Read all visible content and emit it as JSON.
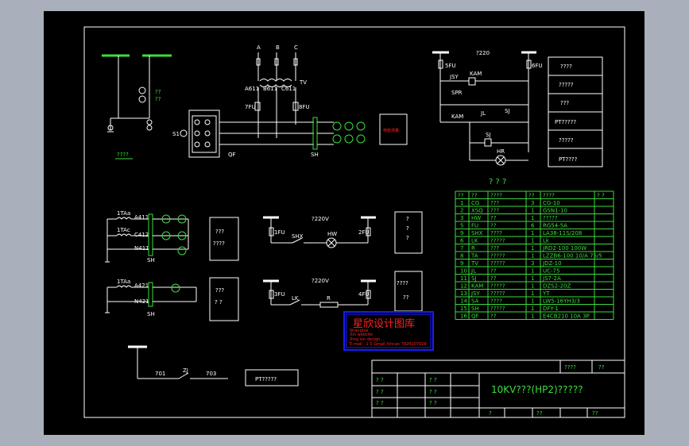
{
  "colors": {
    "background": "#a9b0bc",
    "sheet": "#000000",
    "line": "#ffffff",
    "green": "#3ddc3d",
    "yellow": "#f0f060",
    "stamp_red": "#ff2020",
    "stamp_blue": "#1a1aff"
  },
  "primary": {
    "phases": [
      "A",
      "B",
      "C"
    ],
    "labels": {
      "a611": "A611",
      "b611": "B611",
      "c611": "C611",
      "tv": "TV",
      "fu7": "7FU",
      "fu8": "8FU",
      "s1": "S1",
      "qf": "QF",
      "sh": "SH",
      "qq1": "??",
      "qq2": "??",
      "bottom": "????",
      "box": "电能测量"
    }
  },
  "control": {
    "voltage": "?220",
    "fu5": "5FU",
    "fu6": "6FU",
    "jsy": "JSY",
    "kam1": "KAM",
    "spr": "SPR",
    "kam2": "KAM",
    "jl": "JL",
    "sj1": "SJ",
    "sj2": "SJ",
    "hr": "HR"
  },
  "legend": {
    "items": [
      "????",
      "?????",
      "???",
      "PT?????",
      "?????",
      "PT????"
    ]
  },
  "title_mark": "? ? ?",
  "table": {
    "headers": [
      "??",
      "??",
      "????",
      "??",
      "????",
      "?  ?"
    ],
    "rows": [
      [
        "1",
        "CG",
        "???",
        "3",
        "CG-10",
        ""
      ],
      [
        "2",
        "XSQ",
        "???",
        "1",
        "GSN1-10",
        ""
      ],
      [
        "3",
        "HW",
        "??",
        "1",
        "?????",
        ""
      ],
      [
        "5",
        "FU",
        "??",
        "6",
        "RG54-5A",
        ""
      ],
      [
        "9",
        "SHX",
        "????",
        "1",
        "LA38-11S/208",
        ""
      ],
      [
        "6",
        "LK",
        "?????",
        "1",
        "Lk",
        ""
      ],
      [
        "7",
        "R",
        "???",
        "1",
        "JRD2-100 100W",
        ""
      ],
      [
        "8",
        "TA",
        "?????",
        "1",
        "LZZB6-100 10/A  75/5",
        ""
      ],
      [
        "9",
        "TV",
        "?????",
        "3",
        "JDZ-10",
        ""
      ],
      [
        "10",
        "JL",
        "??",
        "1",
        "UC-75",
        ""
      ],
      [
        "11",
        "SJ",
        "??",
        "1",
        "JS7-2A",
        ""
      ],
      [
        "12",
        "KAM",
        "?????",
        "1",
        "DZS2-20Z",
        ""
      ],
      [
        "13",
        "JSY",
        "?????",
        "1",
        "YT",
        ""
      ],
      [
        "14",
        "SA",
        "????",
        "1",
        "LW5-16YH3/3",
        ""
      ],
      [
        "15",
        "SH",
        "?????",
        "1",
        "DFY-1",
        ""
      ],
      [
        "16",
        "QF",
        "??",
        "1",
        "E4CB210  10A  3P",
        ""
      ]
    ]
  },
  "current_circuits": [
    {
      "ta": "1TAa",
      "ta2": "1TAc",
      "wires": [
        "A411",
        "C412",
        "N411"
      ],
      "sh": "SH",
      "note": [
        "???",
        "????"
      ]
    },
    {
      "ta": "1TAa",
      "wires": [
        "A421",
        "N421"
      ],
      "sh": "SH",
      "note": [
        "???",
        "?   ?"
      ]
    }
  ],
  "aux": [
    {
      "voltage": "?220V",
      "fu_l": "1FU",
      "fu_r": "2FU",
      "sw": "SHX",
      "lamp": "HW",
      "note": [
        "?",
        "?",
        "?"
      ]
    },
    {
      "voltage": "?220V",
      "fu_l": "3FU",
      "fu_r": "4FU",
      "sw": "LK",
      "res": "R",
      "note": [
        "????",
        "??"
      ]
    }
  ],
  "bottom_circuit": {
    "a": "701",
    "sw": "ZJ",
    "b": "703",
    "box": "PT?????"
  },
  "stamp": {
    "title": "星欣设计图库",
    "lines": [
      "Shanghai",
      "Xin website",
      "Xing xin design ... ",
      "E-mail : 1 0 Gmail Xincan 7826107928"
    ]
  },
  "title_block": {
    "title": "10KV???(HP2)?????",
    "cells": [
      "????",
      "??",
      "?  ?",
      "?  ?",
      "?  ?",
      "?  ?",
      "?  ?",
      "?  ?",
      "?",
      "??",
      "??"
    ]
  }
}
